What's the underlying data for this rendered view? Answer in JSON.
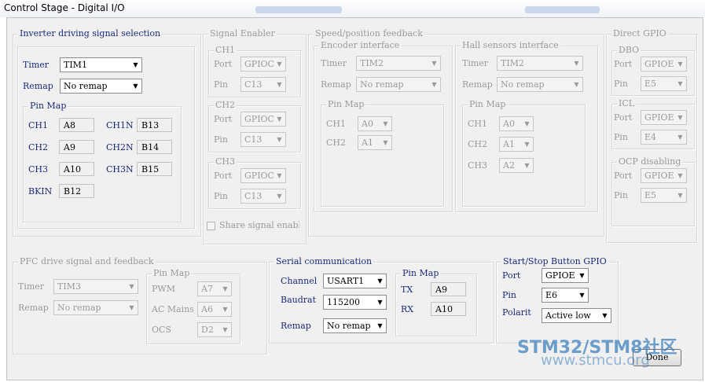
{
  "window": {
    "title": "Control Stage - Digital I/O"
  },
  "inverter": {
    "legend": "Inverter driving signal selection",
    "timer_label": "Timer",
    "timer_value": "TIM1",
    "remap_label": "Remap",
    "remap_value": "No remap",
    "pinmap_legend": "Pin Map",
    "pins": [
      {
        "label": "CH1",
        "value": "A8"
      },
      {
        "label": "CH1N",
        "value": "B13"
      },
      {
        "label": "CH2",
        "value": "A9"
      },
      {
        "label": "CH2N",
        "value": "B14"
      },
      {
        "label": "CH3",
        "value": "A10"
      },
      {
        "label": "CH3N",
        "value": "B15"
      },
      {
        "label": "BKIN",
        "value": "B12"
      }
    ]
  },
  "signal_enabler": {
    "legend": "Signal Enabler",
    "groups": [
      {
        "legend": "CH1",
        "port_label": "Port",
        "port_value": "GPIOC",
        "pin_label": "Pin",
        "pin_value": "C13"
      },
      {
        "legend": "CH2",
        "port_label": "Port",
        "port_value": "GPIOC",
        "pin_label": "Pin",
        "pin_value": "C13"
      },
      {
        "legend": "CH3",
        "port_label": "Port",
        "port_value": "GPIOC",
        "pin_label": "Pin",
        "pin_value": "C13"
      }
    ],
    "share_label": "Share signal enabl"
  },
  "speed_feedback": {
    "legend": "Speed/position feedback",
    "encoder": {
      "legend": "Encoder interface",
      "timer_label": "Timer",
      "timer_value": "TIM2",
      "remap_label": "Remap",
      "remap_value": "No remap",
      "pinmap_legend": "Pin Map",
      "pins": [
        {
          "label": "CH1",
          "value": "A0"
        },
        {
          "label": "CH2",
          "value": "A1"
        }
      ]
    },
    "hall": {
      "legend": "Hall sensors interface",
      "timer_label": "Timer",
      "timer_value": "TIM2",
      "remap_label": "Remap",
      "remap_value": "No remap",
      "pinmap_legend": "Pin Map",
      "pins": [
        {
          "label": "CH1",
          "value": "A0"
        },
        {
          "label": "CH2",
          "value": "A1"
        },
        {
          "label": "CH3",
          "value": "A2"
        }
      ]
    }
  },
  "direct_gpio": {
    "legend": "Direct GPIO",
    "groups": [
      {
        "legend": "DBO",
        "port_label": "Port",
        "port_value": "GPIOE",
        "pin_label": "Pin",
        "pin_value": "E5"
      },
      {
        "legend": "ICL",
        "port_label": "Port",
        "port_value": "GPIOE",
        "pin_label": "Pin",
        "pin_value": "E4"
      },
      {
        "legend": "OCP disabling",
        "port_label": "Port",
        "port_value": "GPIOE",
        "pin_label": "Pin",
        "pin_value": "E5"
      }
    ]
  },
  "pfc": {
    "legend": "PFC drive signal and feedback",
    "timer_label": "Timer",
    "timer_value": "TIM3",
    "remap_label": "Remap",
    "remap_value": "No remap",
    "pinmap_legend": "Pin Map",
    "pins": [
      {
        "label": "PWM",
        "value": "A7"
      },
      {
        "label": "AC Mains",
        "value": "A6"
      },
      {
        "label": "OCS",
        "value": "D2"
      }
    ]
  },
  "serial": {
    "legend": "Serial communication",
    "channel_label": "Channel",
    "channel_value": "USART1",
    "baudrate_label": "Baudrat",
    "baudrate_value": "115200",
    "remap_label": "Remap",
    "remap_value": "No remap",
    "pinmap_legend": "Pin Map",
    "pins": [
      {
        "label": "TX",
        "value": "A9"
      },
      {
        "label": "RX",
        "value": "A10"
      }
    ]
  },
  "startstop": {
    "legend": "Start/Stop Button GPIO",
    "port_label": "Port",
    "port_value": "GPIOE",
    "pin_label": "Pin",
    "pin_value": "E6",
    "polarity_label": "Polarit",
    "polarity_value": "Active low"
  },
  "footer": {
    "done_label": "Done"
  },
  "watermark": {
    "line1": "STM32/STM8社区",
    "line2": "www.stmcu.org"
  },
  "icons": {
    "dropdown_arrow": "▼"
  },
  "colors": {
    "label_blue": "#1a2a7a",
    "disabled_gray": "#9a9a9a",
    "panel_bg": "#f0f0f0"
  }
}
